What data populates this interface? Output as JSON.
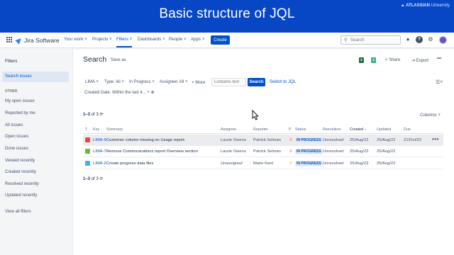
{
  "banner": {
    "title": "Basic structure of JQL",
    "brand_bold": "▲ ATLASSIAN",
    "brand_rest": "University"
  },
  "topnav": {
    "logo_text": "Jira Software",
    "items": [
      "Your work ˅",
      "Projects ˅",
      "Filters ˅",
      "Dashboards ˅",
      "People ˅",
      "Apps ˅"
    ],
    "active_item": "Filters",
    "create_label": "Create",
    "search_placeholder": "Search",
    "icons": [
      "notifications-icon",
      "help-icon",
      "settings-icon",
      "avatar"
    ]
  },
  "sidebar": {
    "heading": "Filters",
    "search_issues": "Search issues",
    "other_label": "OTHER",
    "items": [
      "My open issues",
      "Reported by me",
      "All issues",
      "Open issues",
      "Done issues",
      "Viewed recently",
      "Created recently",
      "Resolved recently",
      "Updated recently"
    ],
    "view_all": "View all filters"
  },
  "main": {
    "title": "Search",
    "save_as": "Save as",
    "share": "Share",
    "export": "Export",
    "accent": "#0052cc"
  },
  "filters": {
    "project": "LIMA ˅",
    "type": "Type: All ˅",
    "status": "In Progress ˅",
    "assignee": "Assignee: All ˅",
    "more": "+ More",
    "contains_placeholder": "Contains text",
    "search_btn": "Search",
    "switch_jql": "Switch to JQL",
    "created_date": "Created Date: Within the last 4... ˅"
  },
  "results": {
    "count_bold": "1–3",
    "count_rest": " of 3",
    "columns_btn": "Columns ˅",
    "headers": [
      "T",
      "Key",
      "Summary",
      "Assignee",
      "Reporter",
      "P",
      "Status",
      "Resolution",
      "Created ↓",
      "Updated",
      "Due"
    ],
    "rows": [
      {
        "type_color": "#e5493a",
        "key": "LIMA-9",
        "summary": "Customer column missing on Usage report",
        "assignee": "Laurie Owens",
        "reporter": "Patrick Selman",
        "priority": "≡",
        "priority_color": "#ff5630",
        "status": "IN PROGRESS",
        "resolution": "Unresolved",
        "created": "25/Aug/22",
        "updated": "25/Aug/22",
        "due": "21/Oct/22"
      },
      {
        "type_color": "#63ba3c",
        "key": "LIMA-7",
        "summary": "Remove Communications report Overview section",
        "assignee": "Laurie Owens",
        "reporter": "Patrick Selman",
        "priority": "≡",
        "priority_color": "#ff5630",
        "status": "IN PROGRESS",
        "resolution": "Unresolved",
        "created": "25/Aug/22",
        "updated": "25/Aug/22",
        "due": ""
      },
      {
        "type_color": "#4bade8",
        "key": "LIMA-2",
        "summary": "Create progress data files",
        "assignee": "Unassigned",
        "reporter": "Marie Kent",
        "priority": "=",
        "priority_color": "#ffab00",
        "status": "IN PROGRESS",
        "resolution": "Unresolved",
        "created": "25/Aug/22",
        "updated": "25/Aug/22",
        "due": ""
      }
    ]
  }
}
